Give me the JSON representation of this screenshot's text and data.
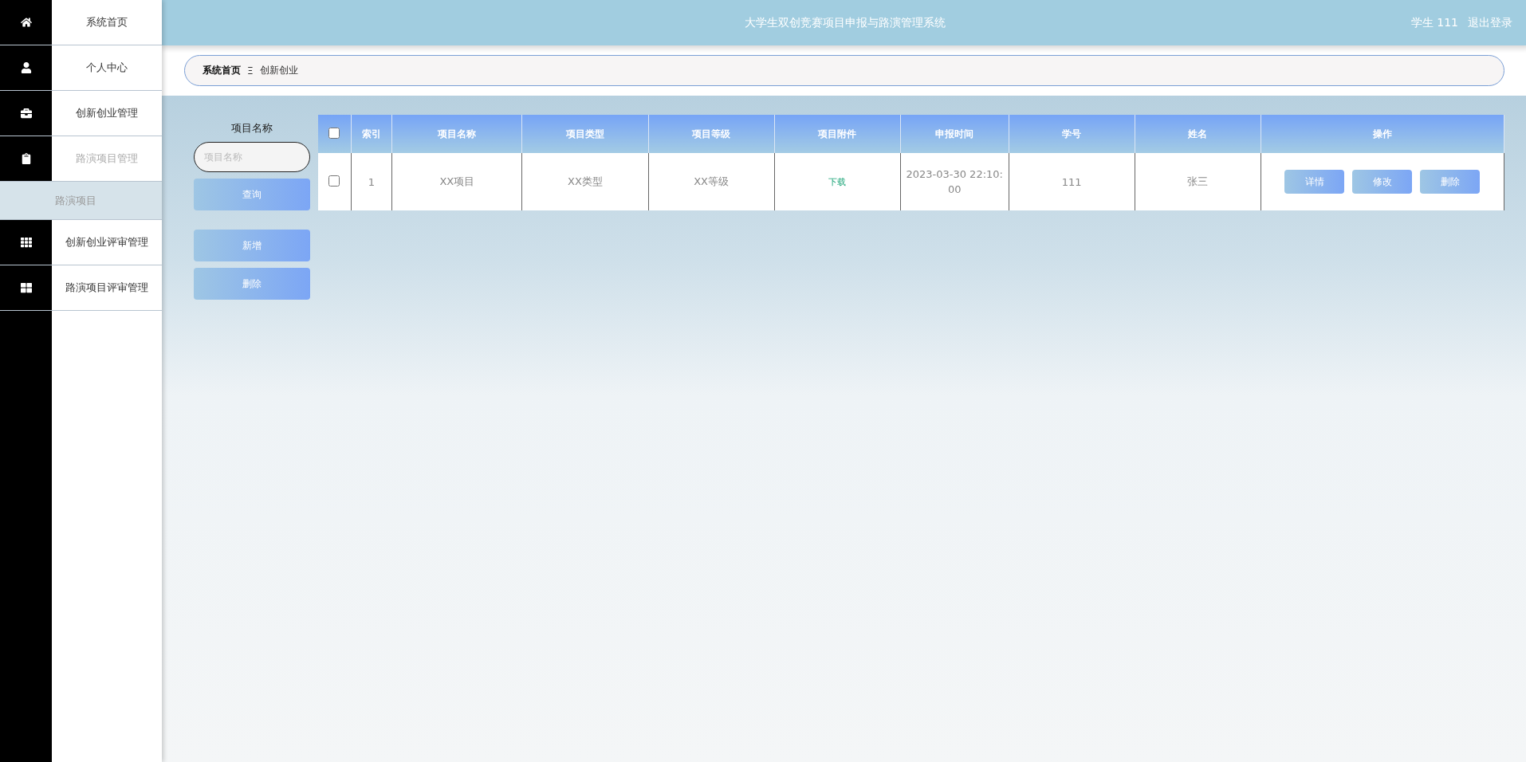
{
  "header": {
    "title": "大学生双创竞赛项目申报与路演管理系统",
    "user": "学生 111",
    "logout": "退出登录"
  },
  "sidebar": {
    "items": [
      {
        "label": "系统首页",
        "expanded": false
      },
      {
        "label": "个人中心",
        "expanded": false
      },
      {
        "label": "创新创业管理",
        "expanded": false
      },
      {
        "label": "路演项目管理",
        "expanded": true,
        "children": [
          {
            "label": "路演项目",
            "selected": true
          }
        ]
      },
      {
        "label": "创新创业评审管理",
        "expanded": false
      },
      {
        "label": "路演项目评审管理",
        "expanded": false
      }
    ]
  },
  "breadcrumb": {
    "home": "系统首页",
    "separator": "Ξ",
    "current": "创新创业"
  },
  "search": {
    "label": "项目名称",
    "placeholder": "项目名称",
    "query_button": "查询",
    "add_button": "新增",
    "delete_button": "删除"
  },
  "table": {
    "select_all_checked": false,
    "columns": [
      "索引",
      "项目名称",
      "项目类型",
      "项目等级",
      "项目附件",
      "申报时间",
      "学号",
      "姓名",
      "操作"
    ],
    "rows": [
      {
        "checked": false,
        "cells": [
          "1",
          "XX项目",
          "XX类型",
          "XX等级"
        ],
        "attachment": "下载",
        "time": "2023-03-30 22:10:00",
        "student_id": "111",
        "name": "张三",
        "actions": [
          "详情",
          "修改",
          "删除"
        ]
      }
    ]
  }
}
